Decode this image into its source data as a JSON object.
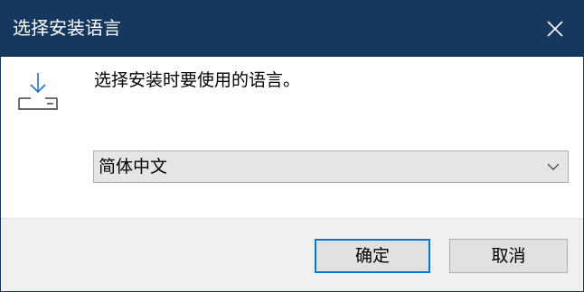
{
  "window": {
    "title": "选择安装语言",
    "close_icon": "close-icon"
  },
  "content": {
    "icon": "install-download-icon",
    "message": "选择安装时要使用的语言。",
    "language_select": {
      "selected": "简体中文",
      "icon": "chevron-down-icon"
    }
  },
  "footer": {
    "ok_label": "确定",
    "cancel_label": "取消"
  },
  "colors": {
    "titlebar": "#17385e",
    "title_text": "#ffffff",
    "footer_bg": "#f0f0f0",
    "button_bg": "#e1e1e1",
    "default_button_border": "#0078d7",
    "select_bg": "#e5e5e5"
  }
}
